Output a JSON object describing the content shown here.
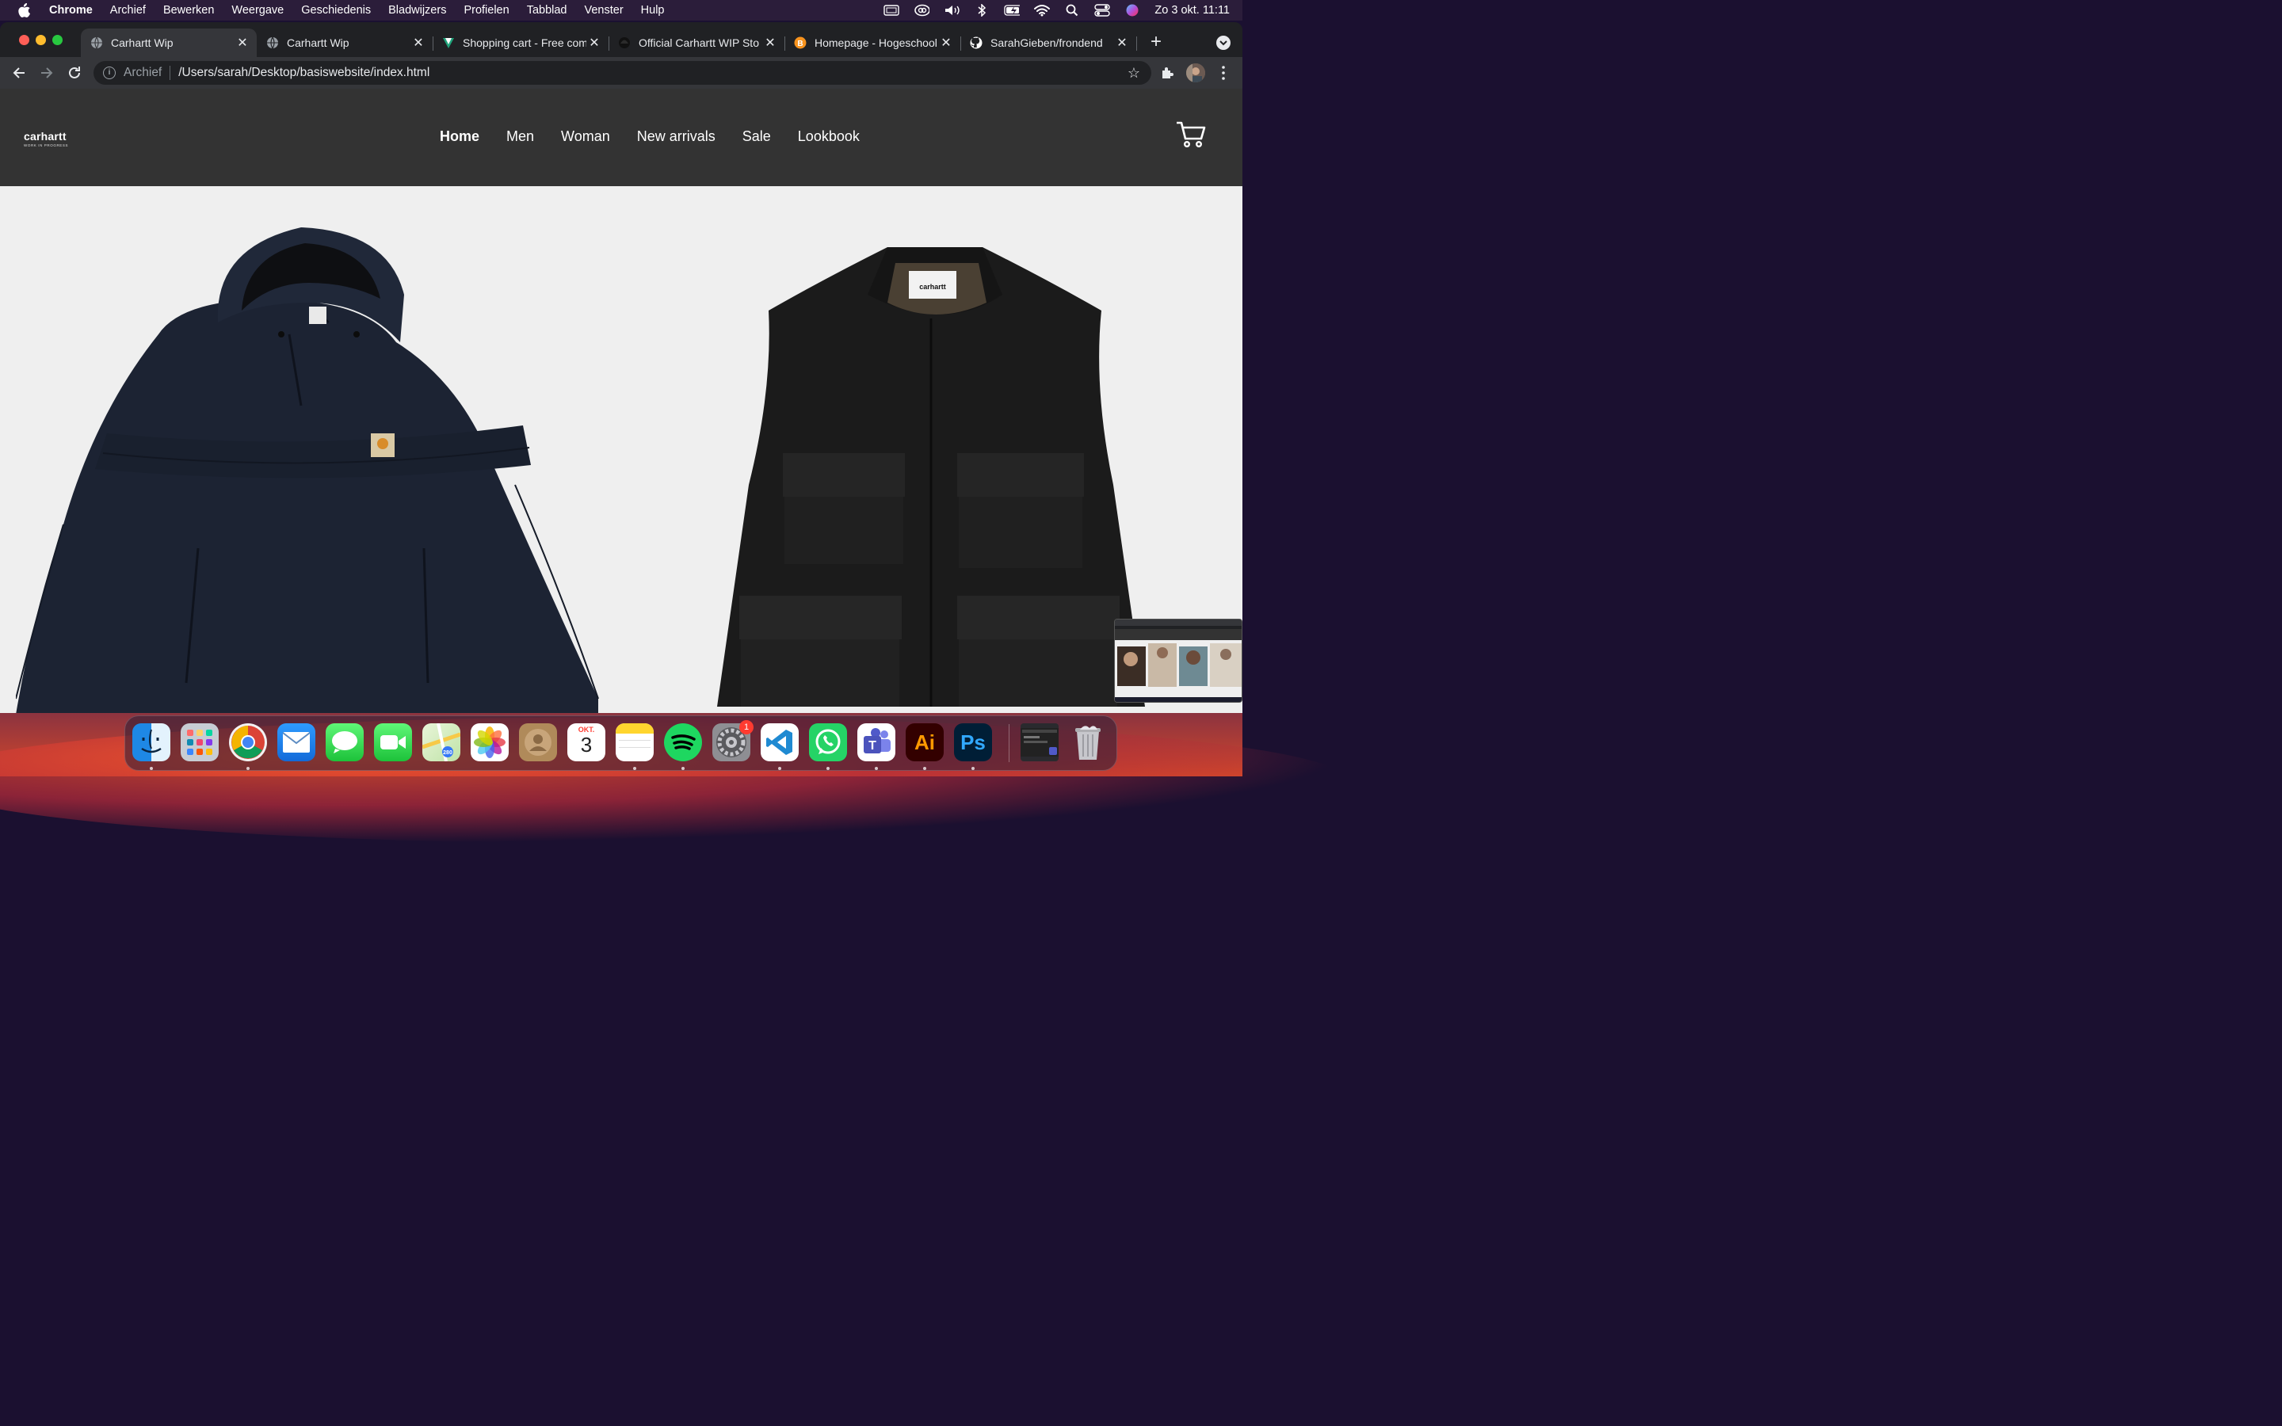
{
  "menubar": {
    "app_name": "Chrome",
    "menus": [
      "Archief",
      "Bewerken",
      "Weergave",
      "Geschiedenis",
      "Bladwijzers",
      "Profielen",
      "Tabblad",
      "Venster",
      "Hulp"
    ],
    "clock": "Zo 3 okt.  11:11",
    "status_icons": [
      "display-icon",
      "creative-cloud-icon",
      "volume-icon",
      "bluetooth-icon",
      "battery-icon",
      "wifi-icon",
      "spotlight-icon",
      "control-center-icon",
      "siri-icon"
    ]
  },
  "browser": {
    "tabs": [
      {
        "title": "Carhartt Wip",
        "favicon": "globe-icon",
        "active": true
      },
      {
        "title": "Carhartt Wip",
        "favicon": "globe-icon",
        "active": false
      },
      {
        "title": "Shopping cart - Free com",
        "favicon": "vuetify-icon",
        "active": false
      },
      {
        "title": "Official Carhartt WIP Sto",
        "favicon": "carhartt-icon",
        "active": false
      },
      {
        "title": "Homepage - Hogeschool",
        "favicon": "hogeschool-icon",
        "active": false
      },
      {
        "title": "SarahGieben/frondend",
        "favicon": "github-icon",
        "active": false
      }
    ],
    "address_scheme": "Archief",
    "address_path": "/Users/sarah/Desktop/basiswebsite/index.html"
  },
  "site": {
    "logo_text": "carhartt",
    "logo_subtext": "WORK IN PROGRESS",
    "nav": [
      "Home",
      "Men",
      "Woman",
      "New arrivals",
      "Sale",
      "Lookbook"
    ],
    "current_nav": "Home",
    "products": [
      {
        "name": "hooded-anorak-jacket",
        "color": "#1c2333"
      },
      {
        "name": "utility-vest",
        "color": "#1b1b1b"
      }
    ]
  },
  "calendar": {
    "month": "OKT.",
    "day": "3"
  },
  "dock": {
    "apps": [
      "Finder",
      "Launchpad",
      "Chrome",
      "Mail",
      "Messages",
      "FaceTime",
      "Maps",
      "Photos",
      "Contacts",
      "Calendar",
      "Notes",
      "Spotify",
      "System Preferences",
      "Visual Studio Code",
      "WhatsApp",
      "Microsoft Teams",
      "Adobe Illustrator",
      "Adobe Photoshop"
    ],
    "system_prefs_badge": "1",
    "illustrator_label": "Ai",
    "photoshop_label": "Ps"
  }
}
